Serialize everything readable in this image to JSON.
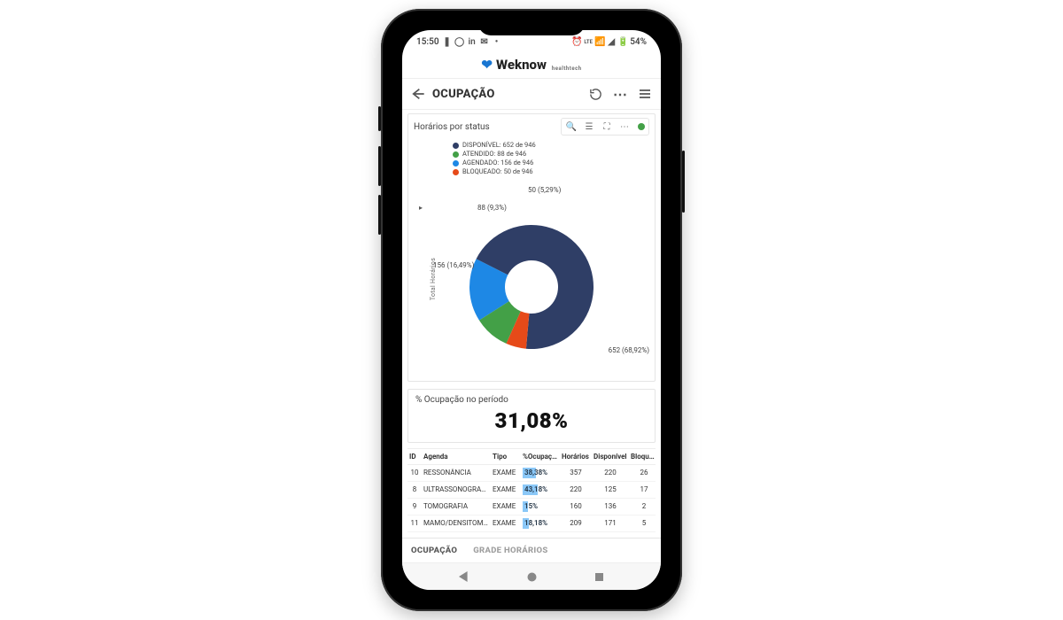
{
  "statusbar": {
    "time": "15:50",
    "battery_text": "54%"
  },
  "brand": {
    "name": "Weknow",
    "sub": "healthtech"
  },
  "titlebar": {
    "title": "OCUPAÇÃO"
  },
  "card1": {
    "title": "Horários por status",
    "axis_label": "Total Horários",
    "legend": [
      {
        "label": "DISPONÍVEL: 652 de 946",
        "color": "#2f3e66"
      },
      {
        "label": "ATENDIDO: 88 de 946",
        "color": "#43a047"
      },
      {
        "label": "AGENDADO: 156 de 946",
        "color": "#1e88e5"
      },
      {
        "label": "BLOQUEADO: 50 de 946",
        "color": "#e64a19"
      }
    ],
    "slice_labels": {
      "disponivel": "652 (68,92%)",
      "atendido": "88 (9,3%)",
      "agendado": "156 (16,49%)",
      "bloqueado": "50 (5,29%)"
    }
  },
  "chart_data": {
    "type": "pie",
    "title": "Horários por status",
    "ylabel": "Total Horários",
    "total": 946,
    "series": [
      {
        "name": "DISPONÍVEL",
        "value": 652,
        "pct": 68.92,
        "color": "#2f3e66"
      },
      {
        "name": "AGENDADO",
        "value": 156,
        "pct": 16.49,
        "color": "#1e88e5"
      },
      {
        "name": "ATENDIDO",
        "value": 88,
        "pct": 9.3,
        "color": "#43a047"
      },
      {
        "name": "BLOQUEADO",
        "value": 50,
        "pct": 5.29,
        "color": "#e64a19"
      }
    ]
  },
  "kpi": {
    "title": "% Ocupação no período",
    "value": "31,08%"
  },
  "table": {
    "headers": [
      "ID",
      "Agenda",
      "Tipo",
      "%Ocupação",
      "Horários",
      "Disponível",
      "Bloquead"
    ],
    "rows": [
      {
        "id": "10",
        "agenda": "RESSONÂNCIA",
        "tipo": "EXAME",
        "occ_text": "38,38%",
        "occ_pct": 38.38,
        "horarios": "357",
        "disponivel": "220",
        "bloq": "26"
      },
      {
        "id": "8",
        "agenda": "ULTRASSONOGRAFIA",
        "tipo": "EXAME",
        "occ_text": "43,18%",
        "occ_pct": 43.18,
        "horarios": "220",
        "disponivel": "125",
        "bloq": "17"
      },
      {
        "id": "9",
        "agenda": "TOMOGRAFIA",
        "tipo": "EXAME",
        "occ_text": "15%",
        "occ_pct": 15,
        "horarios": "160",
        "disponivel": "136",
        "bloq": "2"
      },
      {
        "id": "11",
        "agenda": "MAMO/DENSITOMETRIA",
        "tipo": "EXAME",
        "occ_text": "18,18%",
        "occ_pct": 18.18,
        "horarios": "209",
        "disponivel": "171",
        "bloq": "5"
      }
    ]
  },
  "tabs": {
    "active": "OCUPAÇÃO",
    "other": "GRADE HORÁRIOS"
  }
}
